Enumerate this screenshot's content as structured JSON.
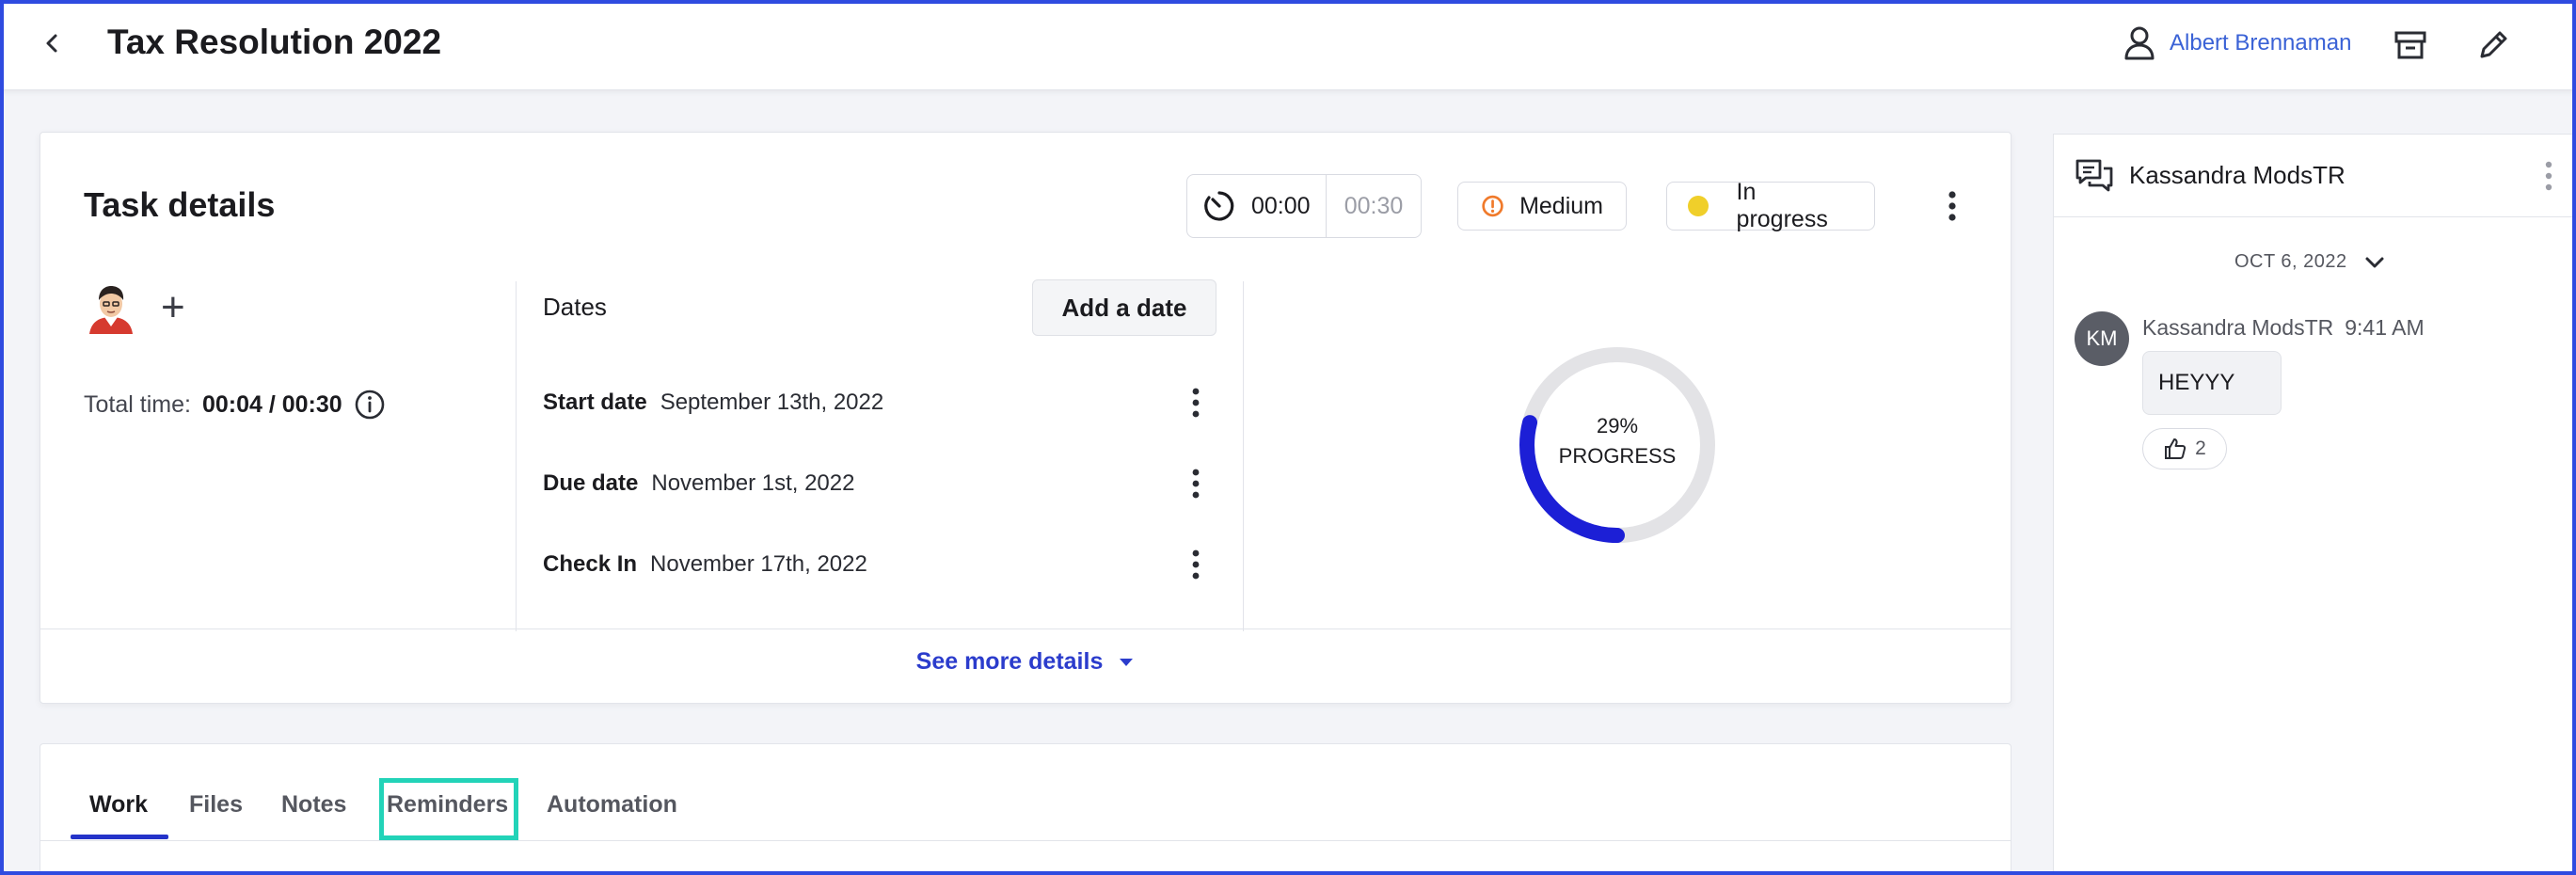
{
  "header": {
    "title": "Tax Resolution 2022",
    "user_name": "Albert Brennaman"
  },
  "task": {
    "title": "Task details",
    "timer": {
      "elapsed": "00:00",
      "estimate": "00:30"
    },
    "priority": {
      "label": "Medium",
      "color": "#f07a2b"
    },
    "status": {
      "label": "In progress",
      "color": "#f0cf2a"
    },
    "total_time_label": "Total time:",
    "total_time_value": "00:04 / 00:30",
    "dates": {
      "heading": "Dates",
      "add_label": "Add a date",
      "items": [
        {
          "label": "Start date",
          "value": "September 13th, 2022"
        },
        {
          "label": "Due date",
          "value": "November 1st, 2022"
        },
        {
          "label": "Check In",
          "value": "November 17th, 2022"
        }
      ]
    },
    "progress": {
      "value_pct": 29,
      "value_label": "29%",
      "caption": "PROGRESS",
      "color": "#1c1fd6"
    },
    "see_more_label": "See more details"
  },
  "tabs": [
    {
      "label": "Work",
      "active": true
    },
    {
      "label": "Files",
      "active": false
    },
    {
      "label": "Notes",
      "active": false
    },
    {
      "label": "Reminders",
      "active": false,
      "highlighted": true
    },
    {
      "label": "Automation",
      "active": false
    }
  ],
  "chat": {
    "channel_name": "Kassandra ModsTR",
    "date_separator": "OCT 6, 2022",
    "messages": [
      {
        "initials": "KM",
        "author": "Kassandra ModsTR",
        "time": "9:41 AM",
        "text": "HEYYY",
        "reaction_count": "2"
      }
    ]
  }
}
